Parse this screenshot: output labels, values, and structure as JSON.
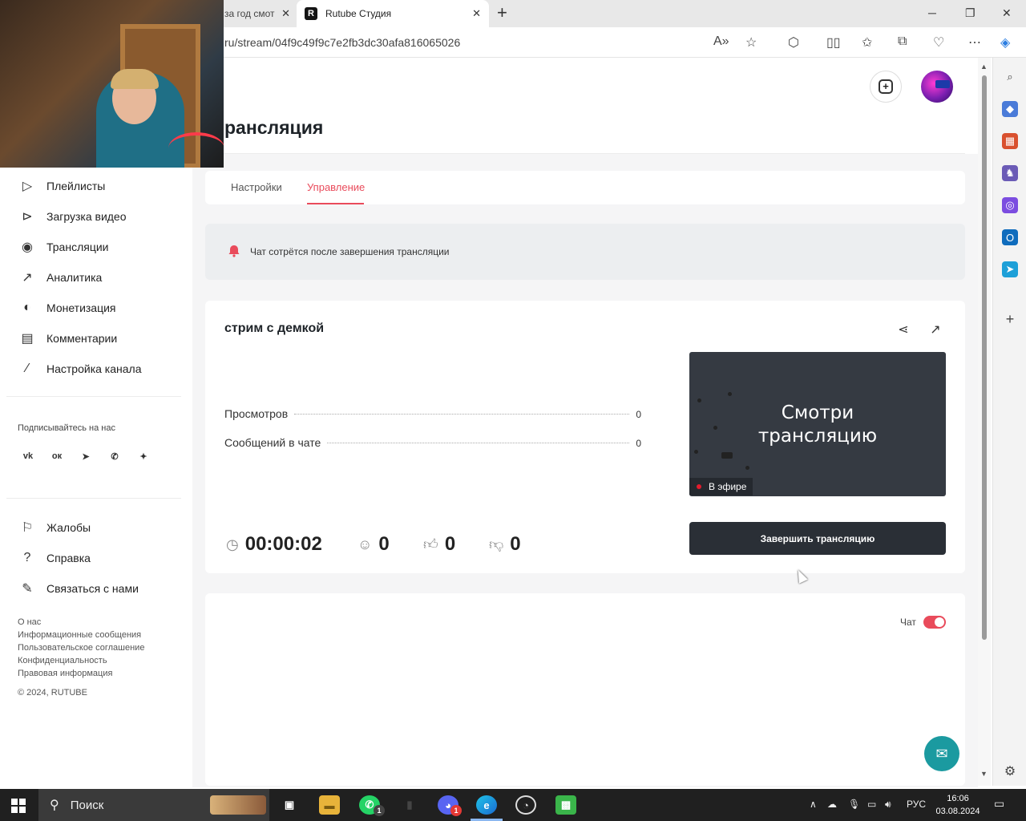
{
  "browser": {
    "tabs": [
      {
        "label": "за год смот"
      },
      {
        "label": "Rutube Студия",
        "favicon": "R"
      }
    ],
    "url": "ru/stream/04f9c49f9c7e2fb3dc30afa816065026"
  },
  "sidebar": {
    "items": [
      {
        "label": "Плейлисты",
        "icon": "playlist-icon"
      },
      {
        "label": "Загрузка видео",
        "icon": "upload-icon"
      },
      {
        "label": "Трансляции",
        "icon": "broadcast-icon"
      },
      {
        "label": "Аналитика",
        "icon": "analytics-icon"
      },
      {
        "label": "Монетизация",
        "icon": "coin-icon"
      },
      {
        "label": "Комментарии",
        "icon": "comments-icon"
      },
      {
        "label": "Настройка канала",
        "icon": "wand-icon"
      }
    ],
    "subscribe_label": "Подписывайтесь на нас",
    "social": [
      "vk-icon",
      "ok-icon",
      "telegram-icon",
      "viber-icon",
      "dzen-icon"
    ],
    "support_items": [
      {
        "label": "Жалобы",
        "icon": "flag-icon"
      },
      {
        "label": "Справка",
        "icon": "help-icon"
      },
      {
        "label": "Связаться с нами",
        "icon": "pen-icon"
      }
    ],
    "footer_links": [
      "О нас",
      "Информационные сообщения",
      "Пользовательское соглашение",
      "Конфиденциальность",
      "Правовая информация"
    ],
    "copyright": "© 2024, RUTUBE"
  },
  "page": {
    "title": "рансляция",
    "tabs": [
      {
        "label": "Настройки",
        "active": false
      },
      {
        "label": "Управление",
        "active": true
      }
    ],
    "notice": "Чат сотрётся после завершения трансляции"
  },
  "stream": {
    "name": "стрим с демкой",
    "stats": [
      {
        "label": "Просмотров",
        "value": "0"
      },
      {
        "label": "Сообщений в чате",
        "value": "0"
      }
    ],
    "duration": "00:00:02",
    "viewers": "0",
    "likes": "0",
    "dislikes": "0",
    "preview_text_line1": "Смотри",
    "preview_text_line2": "трансляцию",
    "live_badge": "В эфире",
    "end_button": "Завершить трансляцию"
  },
  "chat": {
    "label": "Чат",
    "enabled": true
  },
  "taskbar": {
    "search_placeholder": "Поиск",
    "language": "РУС",
    "time": "16:06",
    "date": "03.08.2024",
    "badges": {
      "whatsapp": "1",
      "discord": "1"
    }
  },
  "colors": {
    "accent": "#e94b5b",
    "dark_button": "#2a2f36",
    "fab": "#1b9aa0"
  }
}
